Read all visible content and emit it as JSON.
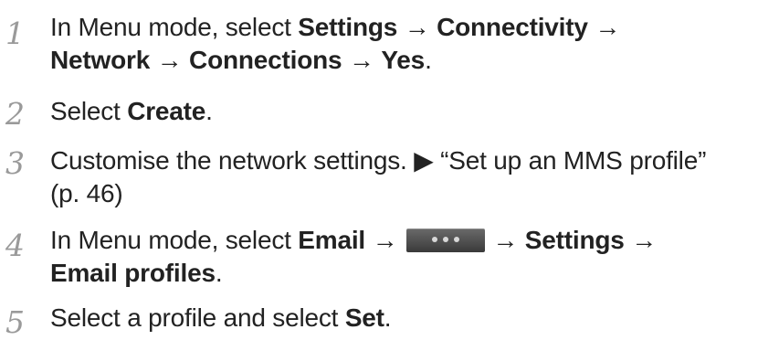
{
  "steps": [
    {
      "number": "1",
      "line1": {
        "t1": "In Menu mode, select ",
        "b1": "Settings",
        "t2": " → ",
        "b2": "Connectivity",
        "t3": " →"
      },
      "line2": {
        "b1": "Network",
        "t1": " → ",
        "b2": "Connections",
        "t2": " → ",
        "b3": "Yes",
        "t3": "."
      }
    },
    {
      "number": "2",
      "line1": {
        "t1": "Select ",
        "b1": "Create",
        "t2": "."
      }
    },
    {
      "number": "3",
      "line1": {
        "t1": "Customise the network settings. ▶ “Set up an MMS profile”"
      },
      "line2": {
        "t1": "(p. 46)"
      }
    },
    {
      "number": "4",
      "line1": {
        "t1": "In Menu mode, select ",
        "b1": "Email",
        "t2": " →",
        "button_icon": "more-dots-icon",
        "t3": "→ ",
        "b2": "Settings",
        "t4": " →"
      },
      "line2": {
        "b1": "Email profiles",
        "t1": "."
      }
    },
    {
      "number": "5",
      "line1": {
        "t1": "Select a profile and select ",
        "b1": "Set",
        "t2": "."
      }
    }
  ]
}
